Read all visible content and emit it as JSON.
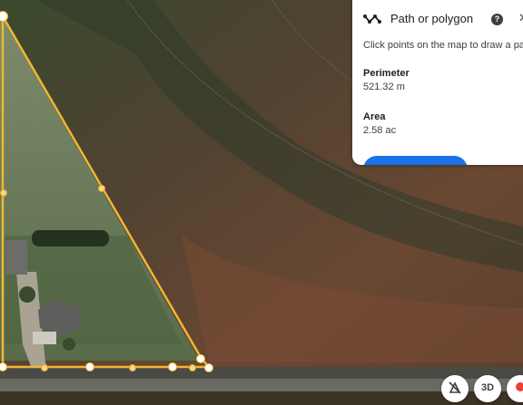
{
  "panel": {
    "icon": "path-polygon-icon",
    "title": "Path or polygon",
    "help_icon": "help-icon",
    "close_icon": "close-icon",
    "instructions": "Click points on the map to draw a path",
    "perimeter_label": "Perimeter",
    "perimeter_value": "521.32 m",
    "area_label": "Area",
    "area_value": "2.58 ac"
  },
  "controls": {
    "compass_icon": "compass-icon",
    "view_3d_label": "3D",
    "location_icon": "location-icon"
  },
  "colors": {
    "polygon_stroke": "#f2b632",
    "accent": "#1a73e8"
  }
}
